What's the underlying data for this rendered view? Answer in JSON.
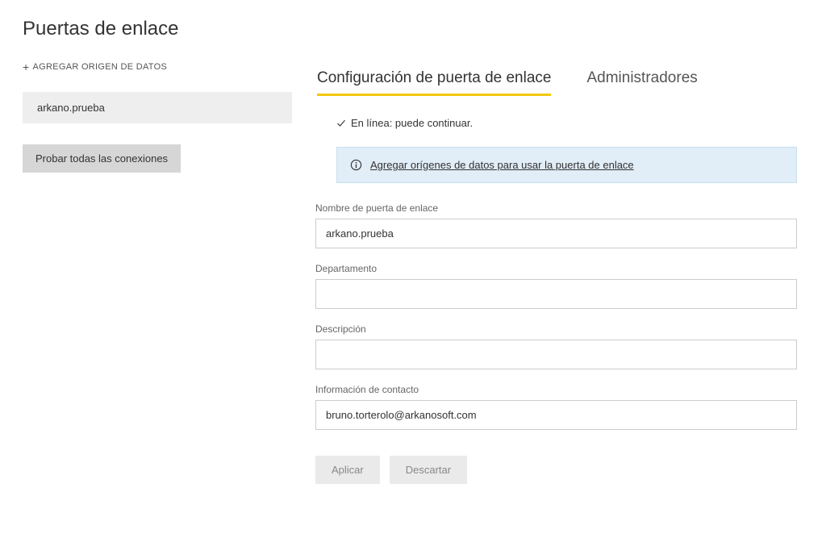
{
  "page": {
    "title": "Puertas de enlace"
  },
  "sidebar": {
    "add_label": "AGREGAR ORIGEN DE DATOS",
    "gateway_name": "arkano.prueba",
    "test_connections_label": "Probar todas las conexiones"
  },
  "tabs": {
    "config": "Configuración de puerta de enlace",
    "admins": "Administradores"
  },
  "status": {
    "text": "En línea: puede continuar."
  },
  "banner": {
    "link_text": "Agregar orígenes de datos para usar la puerta de enlace"
  },
  "form": {
    "name_label": "Nombre de puerta de enlace",
    "name_value": "arkano.prueba",
    "dept_label": "Departamento",
    "dept_value": "",
    "desc_label": "Descripción",
    "desc_value": "",
    "contact_label": "Información de contacto",
    "contact_value": "bruno.torterolo@arkanosoft.com"
  },
  "actions": {
    "apply": "Aplicar",
    "discard": "Descartar"
  }
}
